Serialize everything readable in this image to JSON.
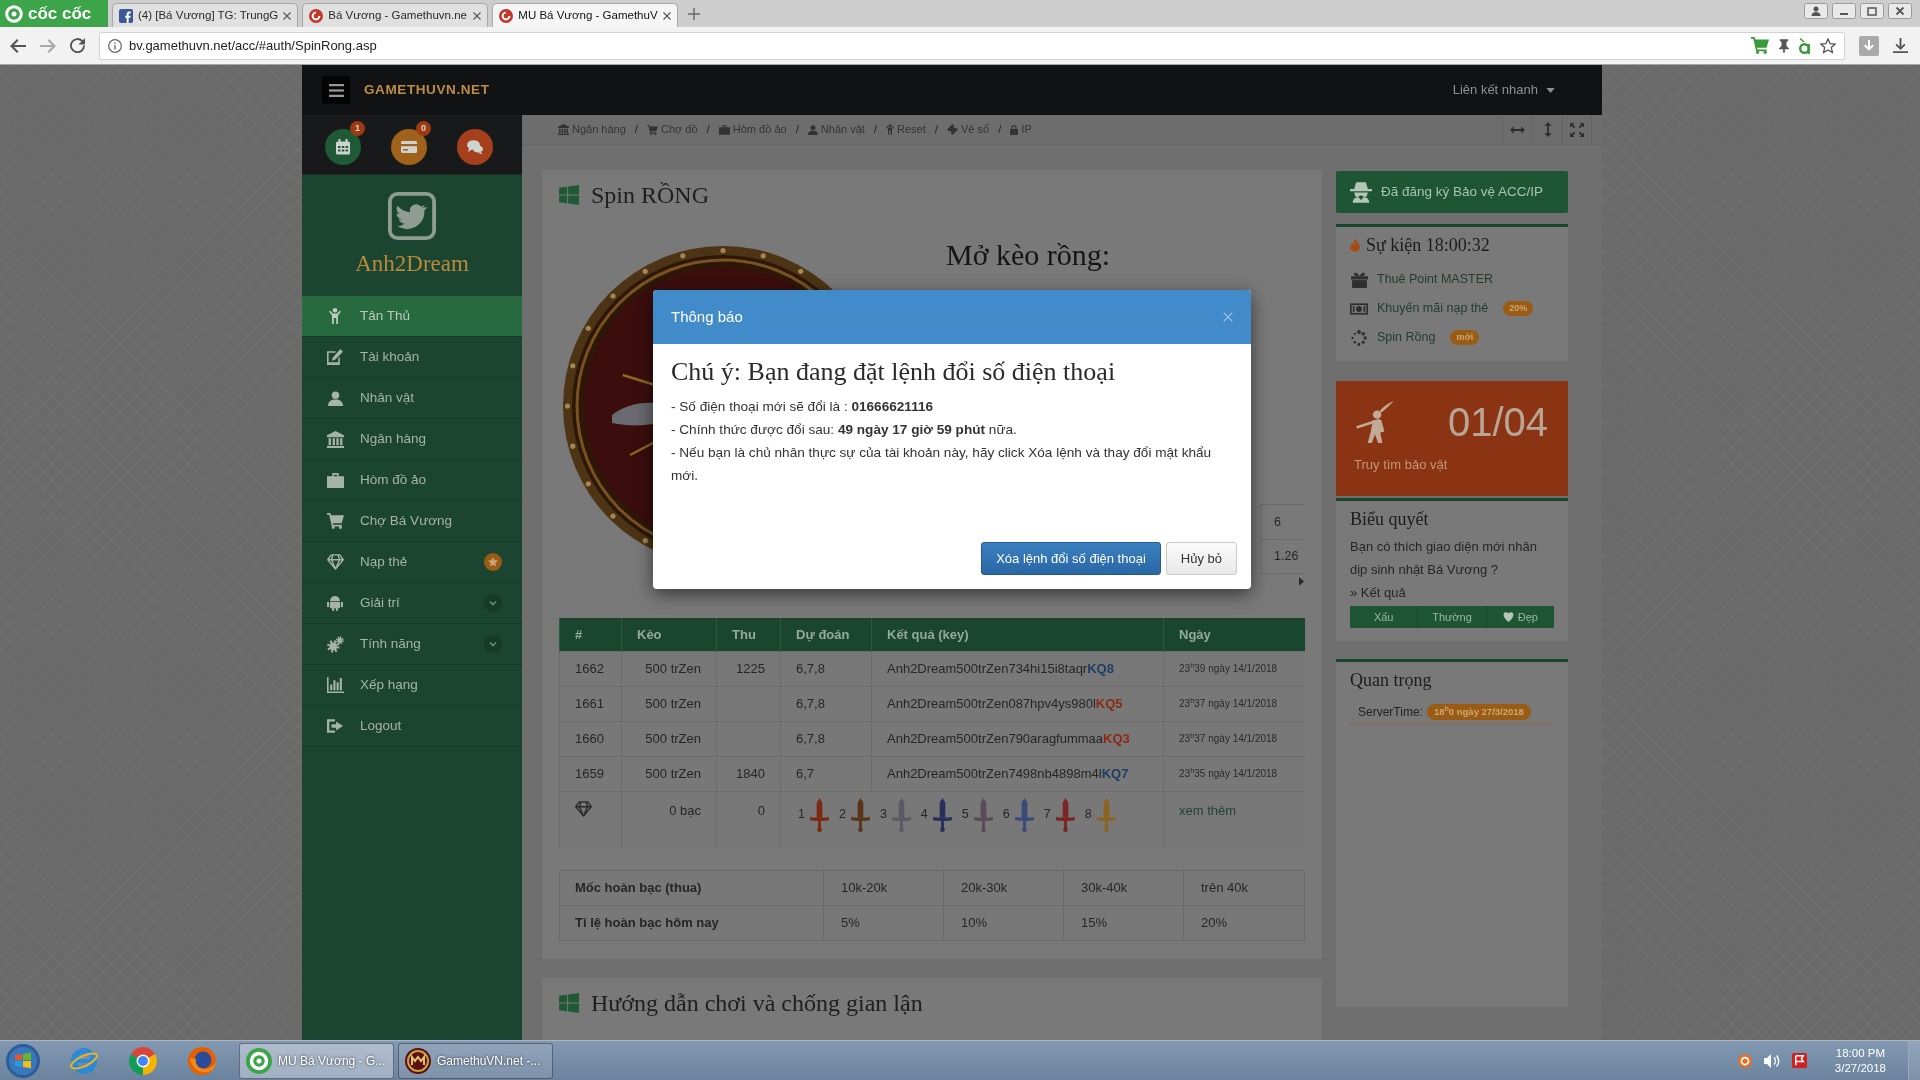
{
  "browser": {
    "logo": "cốc cốc",
    "tabs": [
      {
        "kind": "facebook",
        "title": "(4) [Bá Vương] TG: TrungG",
        "selected": false
      },
      {
        "kind": "game",
        "title": "Bá Vương - Gamethuvn.ne",
        "selected": false
      },
      {
        "kind": "game",
        "title": "MU Bá Vương - GamethuV",
        "selected": true
      }
    ],
    "address": "bv.gamethuvn.net/acc/#auth/SpinRong.asp"
  },
  "navbar": {
    "logo": "GAMETHUVN.NET",
    "quick_links": "Liên kết nhanh"
  },
  "sidebar": {
    "shortcuts": [
      {
        "kind": "calendar",
        "color": "#1f5a37",
        "badge": "1"
      },
      {
        "kind": "wallet",
        "color": "#a0611b",
        "badge": "0"
      },
      {
        "kind": "chat",
        "color": "#a53f1c"
      }
    ],
    "user": "Anh2Dream",
    "menu": [
      {
        "label": "Tân Thủ",
        "kind": "link",
        "selected": true
      },
      {
        "label": "Tài khoản",
        "kind": "link",
        "selected": false
      },
      {
        "label": "Nhân vật",
        "kind": "link",
        "selected": false
      },
      {
        "label": "Ngân hàng",
        "kind": "link",
        "selected": false
      },
      {
        "label": "Hòm đồ ảo",
        "kind": "link",
        "selected": false
      },
      {
        "label": "Chợ Bá Vương",
        "kind": "link",
        "selected": false
      },
      {
        "label": "Nạp thẻ",
        "kind": "starred",
        "selected": false
      },
      {
        "label": "Giải trí",
        "kind": "submenu",
        "selected": false
      },
      {
        "label": "Tính năng",
        "kind": "submenu",
        "selected": false
      },
      {
        "label": "Xếp hạng",
        "kind": "link",
        "selected": false
      },
      {
        "label": "Logout",
        "kind": "link",
        "selected": false
      }
    ]
  },
  "breadcrumb": {
    "items": [
      {
        "label": "Ngân hàng",
        "separator": "/"
      },
      {
        "label": "Chợ đồ",
        "separator": "/"
      },
      {
        "label": "Hòm đồ ảo",
        "separator": "/"
      },
      {
        "label": "Nhân vật",
        "separator": "/"
      },
      {
        "label": "Reset",
        "separator": "/"
      },
      {
        "label": "Vé số",
        "separator": "/"
      },
      {
        "label": "IP"
      }
    ]
  },
  "spin_panel": {
    "title": "Spin RỒNG",
    "heading": "Mở kèo rồng:",
    "side_cells": [
      "6",
      "1.26"
    ],
    "history": {
      "columns": [
        "#",
        "Kèo",
        "Thu",
        "Dự đoán",
        "Kết quả (key)",
        "Ngày"
      ],
      "rows": [
        {
          "id": "1662",
          "bet": "500 trZen",
          "gain": "1225",
          "guess": "6,7,8",
          "key": "Anh2Dream500trZen734hi15i8taqr",
          "result": "KQ8",
          "win": true,
          "date": "23$^{h}$39 ngày 14/1/2018"
        },
        {
          "id": "1661",
          "bet": "500 trZen",
          "guess": "6,7,8",
          "key": "Anh2Dream500trZen087hpv4ys980l",
          "result": "KQ5",
          "win": false,
          "date": "23$^{h}$37 ngày 14/1/2018"
        },
        {
          "id": "1660",
          "bet": "500 trZen",
          "guess": "6,7,8",
          "key": "Anh2Dream500trZen790aragfummaa",
          "result": "KQ3",
          "win": false,
          "date": "23$^{h}$37 ngày 14/1/2018"
        },
        {
          "id": "1659",
          "bet": "500 trZen",
          "gain": "1840",
          "guess": "6,7",
          "key": "Anh2Dream500trZen7498nb4898m4l",
          "result": "KQ7",
          "win": true,
          "date": "23$^{h}$35 ngày 14/1/2018"
        }
      ],
      "summary": {
        "amount": "0 bạc",
        "total": "0",
        "items": [
          "1",
          "2",
          "3",
          "4",
          "5",
          "6",
          "7",
          "8"
        ],
        "more": "xem thêm"
      }
    },
    "refund": {
      "rows": [
        [
          "Mốc hoàn bạc (thua)",
          "10k-20k",
          "20k-30k",
          "30k-40k",
          "trên 40k"
        ],
        [
          "Tỉ lệ hoàn bạc hôm nay",
          "5%",
          "10%",
          "15%",
          "20%"
        ]
      ]
    }
  },
  "guide_panel": {
    "title": "Hướng dẫn chơi và chống gian lận"
  },
  "right_column": {
    "protect_button": "Đã đăng ký Bảo vệ ACC/IP",
    "events": {
      "title": "Sự kiện 18:00:32",
      "items": [
        {
          "label": "Thuê Point MASTER"
        },
        {
          "label": "Khuyến mãi nạp thẻ",
          "tag": "20%"
        },
        {
          "label": "Spin Rồng",
          "tag": "mới"
        }
      ]
    },
    "treasure": {
      "count": "01/04",
      "label": "Truy tìm bảo vật"
    },
    "poll": {
      "title": "Biểu quyết",
      "question": "Bạn có thích giao diện mới nhân dịp sinh nhật Bá Vương ?",
      "result_link": "» Kết quả",
      "options": [
        {
          "label": "Xấu",
          "kind": "plain"
        },
        {
          "label": "Thường",
          "kind": "plain"
        },
        {
          "label": "Đẹp",
          "kind": "heart"
        }
      ]
    },
    "important": {
      "title": "Quan trọng",
      "server_time_label": "ServerTime:",
      "server_time": "18$^{h}$0 ngày 27/3/2018"
    }
  },
  "modal": {
    "title": "Thông báo",
    "heading": "Chú ý: Bạn đang đặt lệnh đổi số điện thoại",
    "lines": [
      "- Số điện thoại mới sẽ đổi là : **01666621116**",
      "- Chính thức được đổi sau: **49 ngày 17 giờ 59 phút** nữa.",
      "- Nếu bạn là chủ nhân thực sự của tài khoản này, hãy click Xóa lệnh và thay đổi mật khẩu mới."
    ],
    "buttons": [
      {
        "kind": "primary",
        "label": "Xóa lệnh đổi số điện thoại"
      },
      {
        "kind": "secondary",
        "label": "Hủy bỏ"
      }
    ]
  },
  "taskbar": {
    "tasks": [
      {
        "kind": "coccoc",
        "label": "MU Bá Vương - G...",
        "selected": true
      },
      {
        "kind": "game",
        "label": "GamethuVN.net -...",
        "selected": false
      }
    ],
    "clock": {
      "time": "18:00 PM",
      "date": "3/27/2018"
    }
  }
}
